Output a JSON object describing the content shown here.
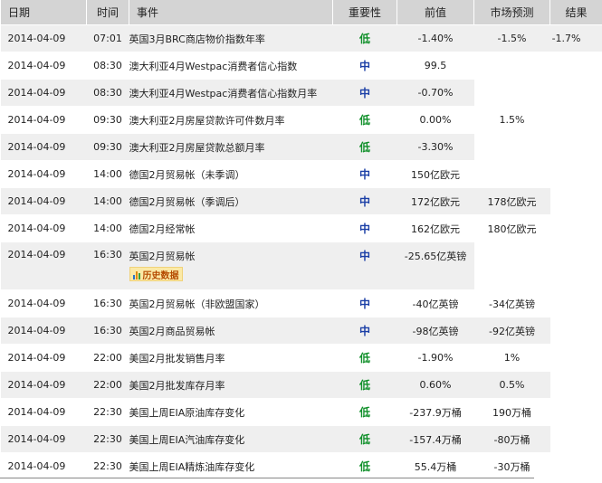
{
  "headers": {
    "date": "日期",
    "time": "时间",
    "event": "事件",
    "importance": "重要性",
    "previous": "前值",
    "forecast": "市场预测",
    "result": "结果"
  },
  "history_link_label": "历史数据",
  "colors": {
    "importance_low": "#10902a",
    "importance_medium": "#1b3fa6",
    "history_badge_bg": "#fbe9a6"
  },
  "rows": [
    {
      "date": "2014-04-09",
      "time": "07:01",
      "event": "英国3月BRC商店物价指数年率",
      "importance": "低",
      "previous": "-1.40%",
      "forecast": "-1.5%",
      "result": "-1.7%"
    },
    {
      "date": "2014-04-09",
      "time": "08:30",
      "event": "澳大利亚4月Westpac消费者信心指数",
      "importance": "中",
      "previous": "99.5",
      "forecast": "",
      "result": ""
    },
    {
      "date": "2014-04-09",
      "time": "08:30",
      "event": "澳大利亚4月Westpac消费者信心指数月率",
      "importance": "中",
      "previous": "-0.70%",
      "forecast": "",
      "result": ""
    },
    {
      "date": "2014-04-09",
      "time": "09:30",
      "event": "澳大利亚2月房屋贷款许可件数月率",
      "importance": "低",
      "previous": "0.00%",
      "forecast": "1.5%",
      "result": ""
    },
    {
      "date": "2014-04-09",
      "time": "09:30",
      "event": "澳大利亚2月房屋贷款总额月率",
      "importance": "低",
      "previous": "-3.30%",
      "forecast": "",
      "result": ""
    },
    {
      "date": "2014-04-09",
      "time": "14:00",
      "event": "德国2月贸易帐（未季调）",
      "importance": "中",
      "previous": "150亿欧元",
      "forecast": "",
      "result": ""
    },
    {
      "date": "2014-04-09",
      "time": "14:00",
      "event": "德国2月贸易帐（季调后）",
      "importance": "中",
      "previous": "172亿欧元",
      "forecast": "178亿欧元",
      "result": ""
    },
    {
      "date": "2014-04-09",
      "time": "14:00",
      "event": "德国2月经常帐",
      "importance": "中",
      "previous": "162亿欧元",
      "forecast": "180亿欧元",
      "result": ""
    },
    {
      "date": "2014-04-09",
      "time": "16:30",
      "event": "英国2月贸易帐",
      "importance": "中",
      "previous": "-25.65亿英镑",
      "forecast": "",
      "result": ""
    },
    {
      "date": "2014-04-09",
      "time": "16:30",
      "event": "英国2月贸易帐（非欧盟国家）",
      "importance": "中",
      "previous": "-40亿英镑",
      "forecast": "-34亿英镑",
      "result": ""
    },
    {
      "date": "2014-04-09",
      "time": "16:30",
      "event": "英国2月商品贸易帐",
      "importance": "中",
      "previous": "-98亿英镑",
      "forecast": "-92亿英镑",
      "result": ""
    },
    {
      "date": "2014-04-09",
      "time": "22:00",
      "event": "美国2月批发销售月率",
      "importance": "低",
      "previous": "-1.90%",
      "forecast": "1%",
      "result": ""
    },
    {
      "date": "2014-04-09",
      "time": "22:00",
      "event": "美国2月批发库存月率",
      "importance": "低",
      "previous": "0.60%",
      "forecast": "0.5%",
      "result": ""
    },
    {
      "date": "2014-04-09",
      "time": "22:30",
      "event": "美国上周EIA原油库存变化",
      "importance": "低",
      "previous": "-237.9万桶",
      "forecast": "190万桶",
      "result": ""
    },
    {
      "date": "2014-04-09",
      "time": "22:30",
      "event": "美国上周EIA汽油库存变化",
      "importance": "低",
      "previous": "-157.4万桶",
      "forecast": "-80万桶",
      "result": ""
    },
    {
      "date": "2014-04-09",
      "time": "22:30",
      "event": "美国上周EIA精炼油库存变化",
      "importance": "低",
      "previous": "55.4万桶",
      "forecast": "-30万桶",
      "result": ""
    }
  ]
}
